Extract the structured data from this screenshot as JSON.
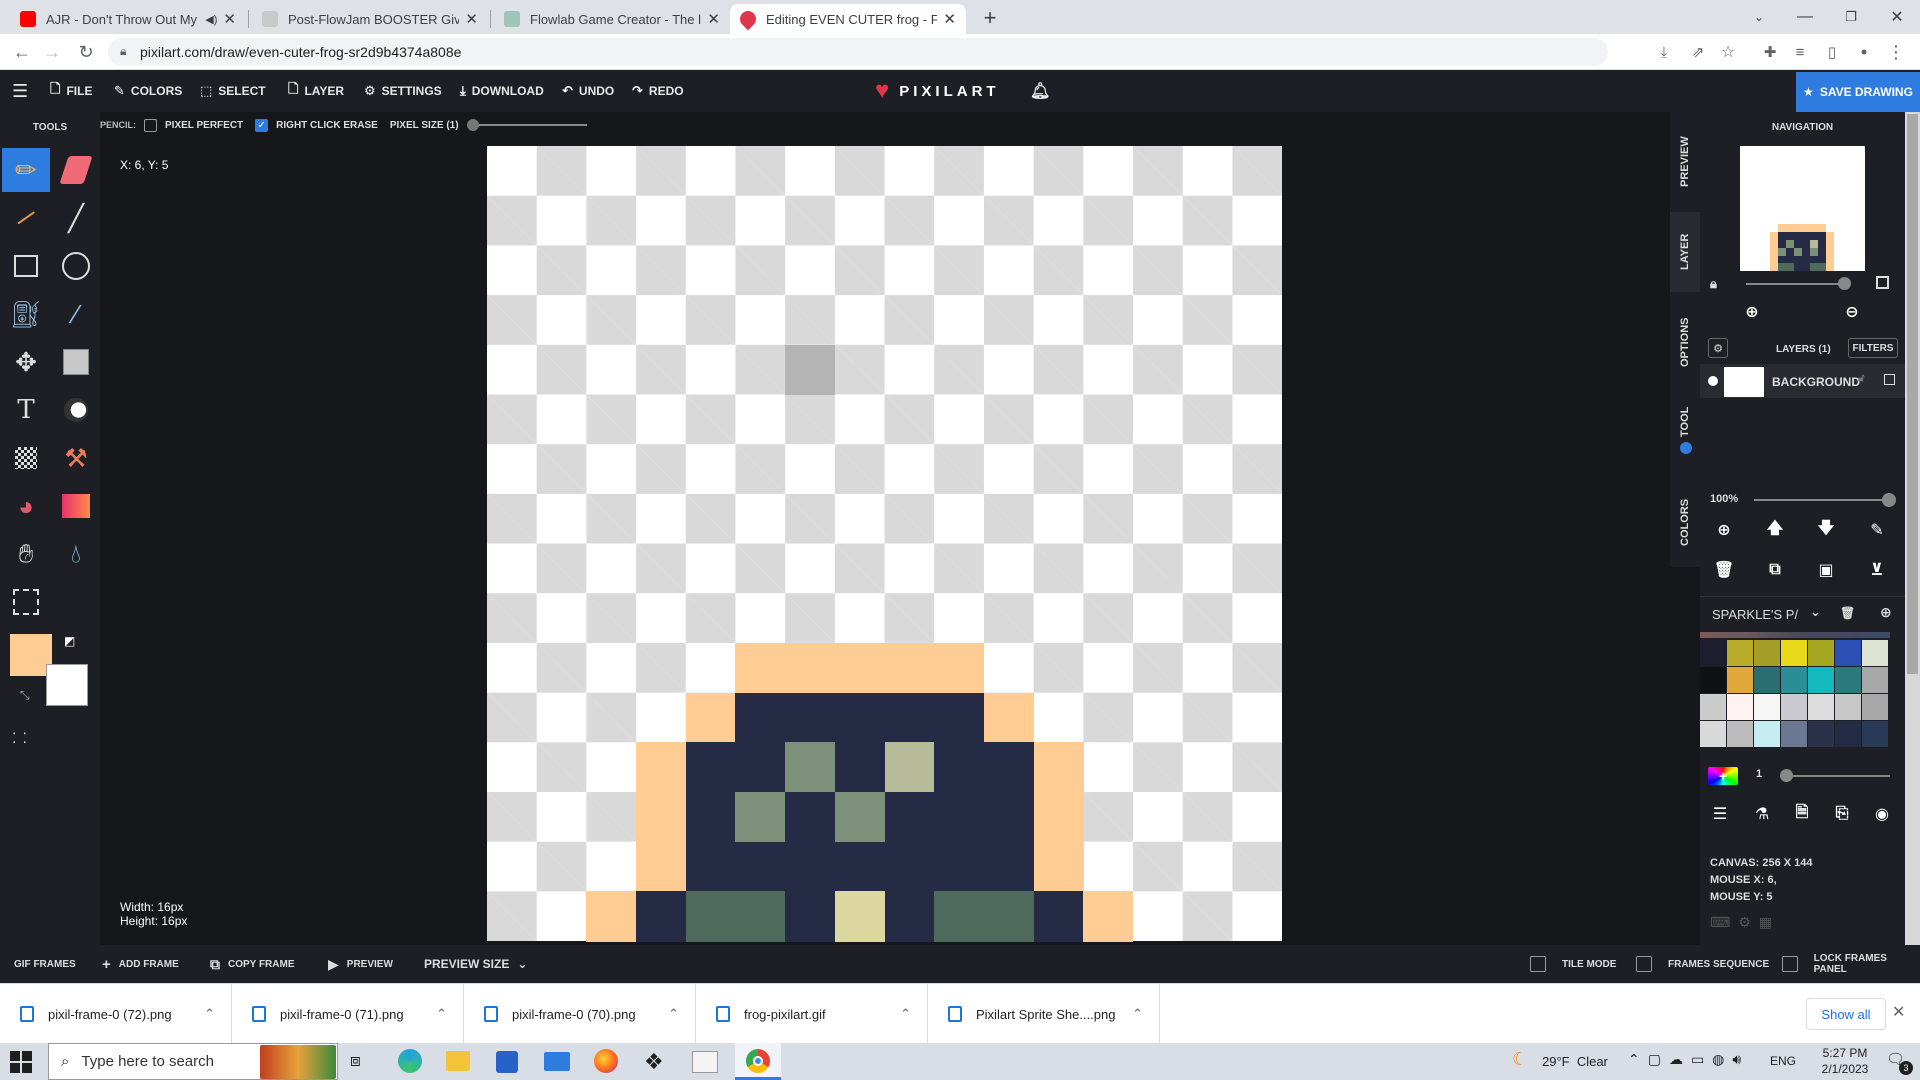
{
  "browser": {
    "tabs": [
      {
        "title": "AJR - Don't Throw Out My Le",
        "favicon_color": "#ff0000"
      },
      {
        "title": "Post-FlowJam BOOSTER Giveaw",
        "favicon_color": "#c9c9c9"
      },
      {
        "title": "Flowlab Game Creator - The last",
        "favicon_color": "#9fc5b8"
      },
      {
        "title": "Editing EVEN CUTER frog - Free c",
        "favicon_color": "#e0364a"
      }
    ],
    "new_tab": "+",
    "url": "pixilart.com/draw/even-cuter-frog-sr2d9b4374a808e"
  },
  "toolbar": {
    "menu_icon": "hamburger-icon",
    "file": "FILE",
    "colors": "COLORS",
    "select": "SELECT",
    "layer": "LAYER",
    "settings": "SETTINGS",
    "download": "DOWNLOAD",
    "undo": "UNDO",
    "redo": "REDO",
    "logo": "PIXILART",
    "save": "SAVE DRAWING"
  },
  "options": {
    "tool_name": "PENCIL:",
    "pixel_perfect": "PIXEL PERFECT",
    "pixel_perfect_checked": false,
    "right_click_erase": "RIGHT CLICK ERASE",
    "right_click_erase_checked": true,
    "pixel_size": "PIXEL SIZE (1)",
    "pixel_size_value": 1
  },
  "tools_panel": {
    "title": "TOOLS",
    "primary_color": "#ffcd94",
    "secondary_color": "#ffffff"
  },
  "canvas": {
    "coords": "X: 6, Y: 5",
    "width_label": "Width: 16px",
    "height_label": "Height: 16px",
    "grid_size": 16,
    "palette": {
      "1": "#ffcd94",
      "2": "#252a45",
      "3": "#7d907a",
      "4": "#b7bb9a",
      "5": "#4e6a5d",
      "6": "#dcd79f",
      "7": "#b4b4b4"
    },
    "rows": [
      "0000000000000000",
      "0000000000000000",
      "0000000000000000",
      "0000000000000000",
      "0000007000000000",
      "0000000000000000",
      "0000000000000000",
      "0000000000000000",
      "0000000000000000",
      "0000000000000000",
      "0000011111000000",
      "0000122222100000",
      "0001223242210000",
      "0001232322210000",
      "0001222222210000",
      "0012552625521000"
    ]
  },
  "side_tabs": [
    "PREVIEW",
    "LAYER",
    "OPTIONS",
    "TOOL",
    "COLORS"
  ],
  "right_panel": {
    "navigation": "NAVIGATION",
    "layers_title": "LAYERS (1)",
    "filters": "FILTERS",
    "layer_name": "BACKGROUND",
    "opacity": "100%",
    "opacity_value": 100,
    "palette_name": "SPARKLE'S P/",
    "palette_rows": [
      [
        "#1d1f2e",
        "#b8ac2a",
        "#a49d28",
        "#e8d81a",
        "#a7a622",
        "#2c4fb5",
        "#dde5d2"
      ],
      [
        "#101112",
        "#e0a83a",
        "#2b6d70",
        "#2a8e94",
        "#14b9bd",
        "#2a7a7e",
        "#a8a8a8"
      ],
      [
        "#cccccc",
        "#fff2f2",
        "#f6f6f6",
        "#c9c9cf",
        "#dcdcdc",
        "#c8c8c8",
        "#a9a9a9"
      ],
      [
        "#d9d9d9",
        "#bcbcbc",
        "#c4ecf2",
        "#6b7891",
        "#2a3148",
        "#252a45",
        "#283a55"
      ]
    ],
    "brush_size": "1",
    "canvas_info": "CANVAS: 256 X 144",
    "mouse_x": "MOUSE X: 6,",
    "mouse_y": "MOUSE Y: 5"
  },
  "frames_bar": {
    "gif_frames": "GIF FRAMES",
    "add_frame": "ADD FRAME",
    "copy_frame": "COPY FRAME",
    "preview": "PREVIEW",
    "preview_size": "PREVIEW SIZE",
    "tile_mode": "TILE MODE",
    "frames_sequence": "FRAMES SEQUENCE",
    "lock_frames": "LOCK FRAMES PANEL"
  },
  "downloads": {
    "items": [
      "pixil-frame-0 (72).png",
      "pixil-frame-0 (71).png",
      "pixil-frame-0 (70).png",
      "frog-pixilart.gif",
      "Pixilart Sprite She....png"
    ],
    "show_all": "Show all"
  },
  "taskbar": {
    "search": "Type here to search",
    "weather": "29°F  Clear",
    "lang": "ENG",
    "time": "5:27 PM",
    "date": "2/1/2023",
    "notif_count": "3"
  }
}
